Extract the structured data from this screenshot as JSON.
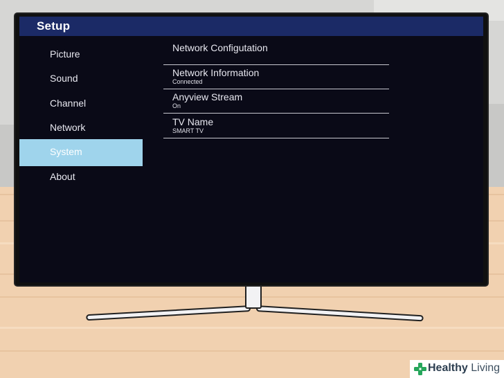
{
  "screen": {
    "title": "Setup",
    "menu": [
      {
        "label": "Picture",
        "selected": false
      },
      {
        "label": "Sound",
        "selected": false
      },
      {
        "label": "Channel",
        "selected": false
      },
      {
        "label": "Network",
        "selected": false
      },
      {
        "label": "System",
        "selected": true
      },
      {
        "label": "About",
        "selected": false
      }
    ],
    "rows": [
      {
        "title": "Network Configutation",
        "subtitle": ""
      },
      {
        "title": "Network Information",
        "subtitle": "Connected"
      },
      {
        "title": "Anyview Stream",
        "subtitle": "On"
      },
      {
        "title": "TV Name",
        "subtitle": "SMART TV"
      }
    ]
  },
  "watermark": {
    "brand_bold": "Healthy",
    "brand_light": " Living",
    "icon": "plus-icon"
  },
  "colors": {
    "header_bar": "#1b2a66",
    "screen_bg": "#0a0a17",
    "selected_item": "#9fd4ec",
    "watermark_green": "#26a65b"
  }
}
